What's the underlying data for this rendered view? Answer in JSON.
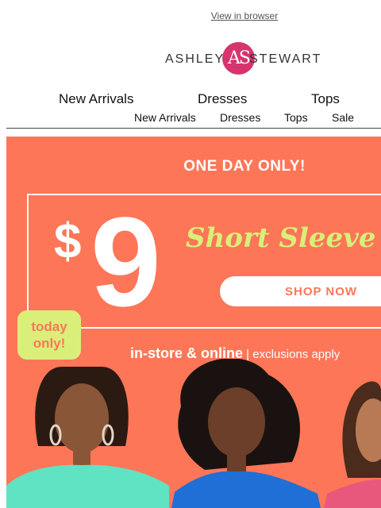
{
  "header": {
    "view_in_browser": "View in browser",
    "logo_left": "ASHLEY",
    "logo_mark": "AS",
    "logo_right": "STEWART"
  },
  "nav_main": [
    "New Arrivals",
    "Dresses",
    "Tops"
  ],
  "nav_sub": [
    "New Arrivals",
    "Dresses",
    "Tops",
    "Sale"
  ],
  "hero": {
    "headline": "ONE DAY ONLY!",
    "price_symbol": "$",
    "price": "9",
    "product": "Short Sleeve T",
    "cta": "SHOP NOW",
    "badge_line1": "today",
    "badge_line2": "only!",
    "channels": "in-store & online",
    "exclusions": " | exclusions apply"
  },
  "colors": {
    "brand_pink": "#d7336f",
    "hero_bg": "#fd7657",
    "accent_lime": "#d9ef79",
    "model_left_top": "#5fe3c3",
    "model_center_top": "#1f6fd6",
    "model_right_top": "#e8577c"
  }
}
